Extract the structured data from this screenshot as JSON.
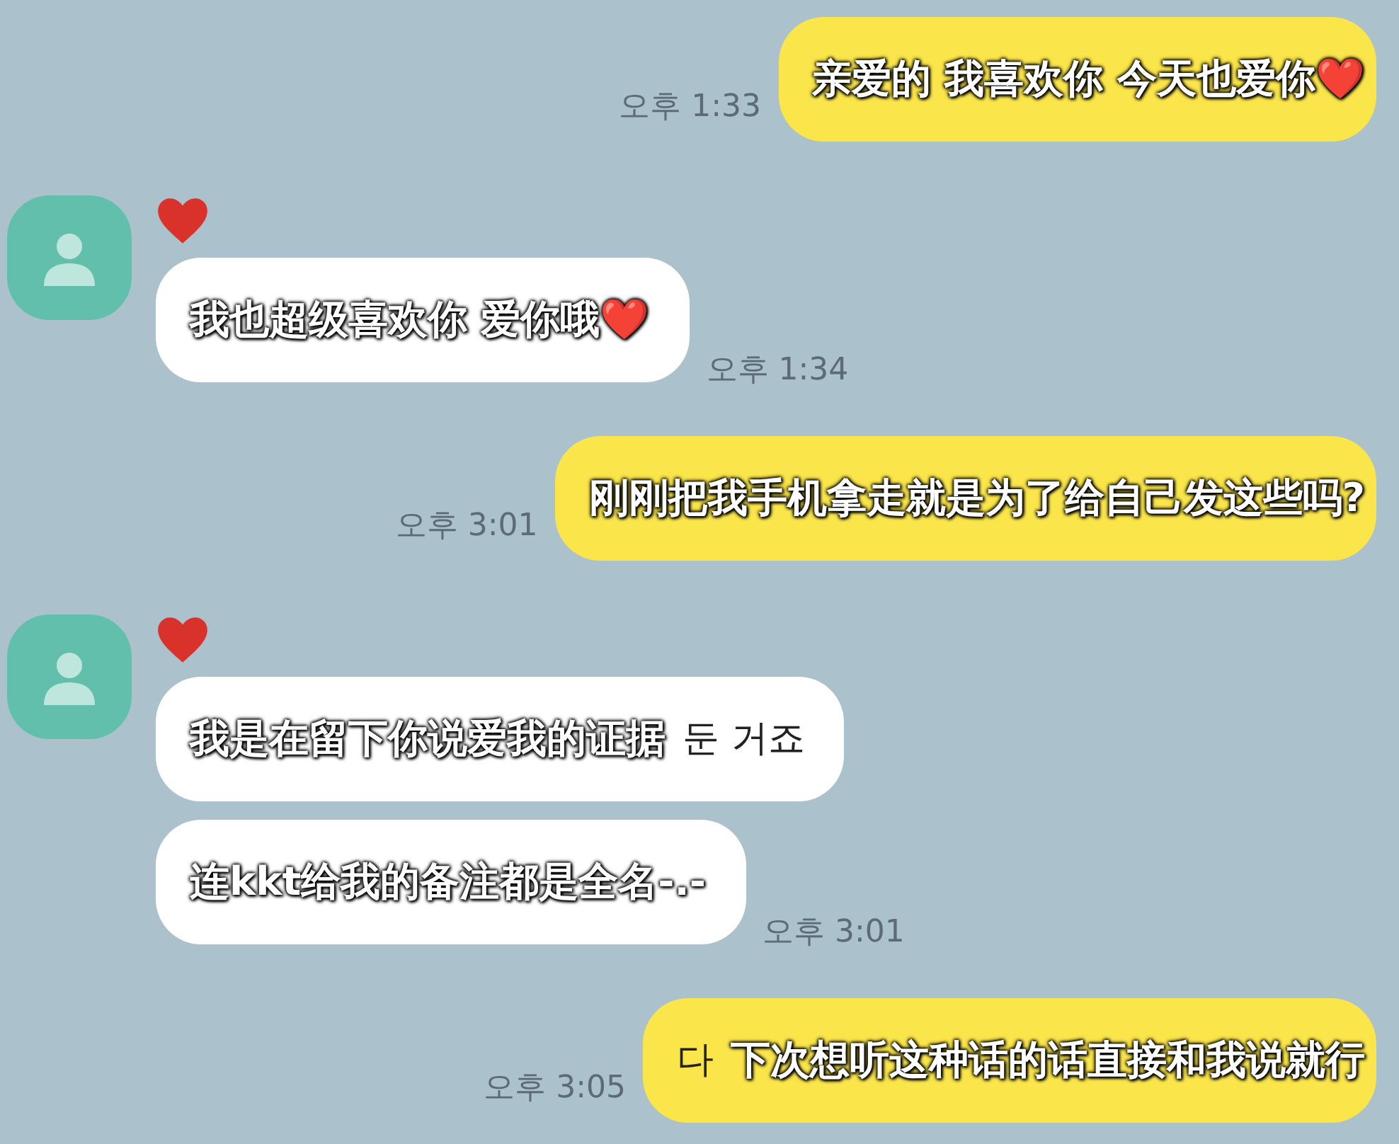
{
  "messages": [
    {
      "kind": "sent",
      "bubbles": [
        {
          "parts": [
            {
              "kind": "subtitle",
              "text": "亲爱的 我喜欢你 今天也爱你❤️"
            }
          ]
        }
      ],
      "time": "오후 1:33"
    },
    {
      "kind": "received",
      "reacted": true,
      "bubbles": [
        {
          "parts": [
            {
              "kind": "subtitle",
              "text": "我也超级喜欢你 爱你哦❤️"
            }
          ]
        }
      ],
      "time": "오후 1:34"
    },
    {
      "kind": "sent",
      "bubbles": [
        {
          "parts": [
            {
              "kind": "subtitle",
              "text": "刚刚把我手机拿走就是为了给自己发这些吗?"
            }
          ]
        }
      ],
      "time": "오후 3:01"
    },
    {
      "kind": "received",
      "reacted": true,
      "bubbles": [
        {
          "parts": [
            {
              "kind": "subtitle",
              "text": "我是在留下你说爱我的证据"
            },
            {
              "kind": "plain",
              "text": "둔 거죠"
            }
          ]
        },
        {
          "parts": [
            {
              "kind": "subtitle",
              "text": "连kkt给我的备注都是全名-.-"
            }
          ]
        }
      ],
      "time": "오후 3:01"
    },
    {
      "kind": "sent",
      "bubbles": [
        {
          "parts": [
            {
              "kind": "plain",
              "text": "다"
            },
            {
              "kind": "subtitle",
              "text": "下次想听这种话的话直接和我说就行"
            }
          ]
        }
      ],
      "time": "오후 3:05"
    }
  ]
}
